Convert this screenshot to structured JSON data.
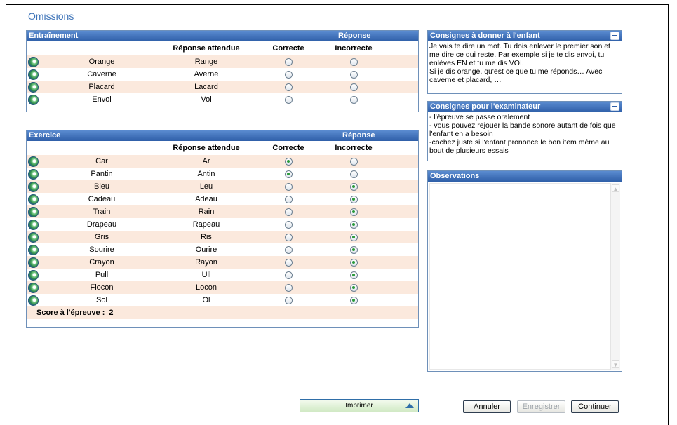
{
  "page": {
    "title": "Omissions"
  },
  "training": {
    "title": "Entraînement",
    "response_header": "Réponse",
    "col_expected": "Réponse attendue",
    "col_correct": "Correcte",
    "col_incorrect": "Incorrecte",
    "rows": [
      {
        "word": "Orange",
        "expected": "Range",
        "correct": false,
        "incorrect": false
      },
      {
        "word": "Caverne",
        "expected": "Averne",
        "correct": false,
        "incorrect": false
      },
      {
        "word": "Placard",
        "expected": "Lacard",
        "correct": false,
        "incorrect": false
      },
      {
        "word": "Envoi",
        "expected": "Voi",
        "correct": false,
        "incorrect": false
      }
    ]
  },
  "exercise": {
    "title": "Exercice",
    "response_header": "Réponse",
    "col_expected": "Réponse attendue",
    "col_correct": "Correcte",
    "col_incorrect": "Incorrecte",
    "rows": [
      {
        "word": "Car",
        "expected": "Ar",
        "correct": true,
        "incorrect": false
      },
      {
        "word": "Pantin",
        "expected": "Antin",
        "correct": true,
        "incorrect": false
      },
      {
        "word": "Bleu",
        "expected": "Leu",
        "correct": false,
        "incorrect": true
      },
      {
        "word": "Cadeau",
        "expected": "Adeau",
        "correct": false,
        "incorrect": true
      },
      {
        "word": "Train",
        "expected": "Rain",
        "correct": false,
        "incorrect": true
      },
      {
        "word": "Drapeau",
        "expected": "Rapeau",
        "correct": false,
        "incorrect": true
      },
      {
        "word": "Gris",
        "expected": "Ris",
        "correct": false,
        "incorrect": true
      },
      {
        "word": "Sourire",
        "expected": "Ourire",
        "correct": false,
        "incorrect": true
      },
      {
        "word": "Crayon",
        "expected": "Rayon",
        "correct": false,
        "incorrect": true
      },
      {
        "word": "Pull",
        "expected": "Ull",
        "correct": false,
        "incorrect": true
      },
      {
        "word": "Flocon",
        "expected": "Locon",
        "correct": false,
        "incorrect": true
      },
      {
        "word": "Sol",
        "expected": "Ol",
        "correct": false,
        "incorrect": true
      }
    ],
    "score_label": "Score à l'épreuve :",
    "score_value": "2"
  },
  "child_instructions": {
    "title": "Consignes à donner à l'enfant",
    "text": "Je vais te dire un mot. Tu dois enlever le premier son et me dire ce qui reste. Par exemple si je te dis envoi, tu enlèves EN et tu me dis VOI.\nSi je dis orange, qu'est ce que tu me réponds… Avec caverne et placard, …"
  },
  "examiner_instructions": {
    "title": "Consignes pour l'examinateur",
    "text": "- l'épreuve se passe oralement\n- vous pouvez rejouer la bande sonore autant de fois que l'enfant en a besoin\n-cochez juste si l'enfant prononce le bon item même au bout de plusieurs essais"
  },
  "observations": {
    "title": "Observations",
    "value": ""
  },
  "buttons": {
    "print": "Imprimer",
    "cancel": "Annuler",
    "save": "Enregistrer",
    "continue": "Continuer"
  },
  "icons": {
    "play": "play-sound-icon",
    "minimize": "minimize-icon",
    "print_arrow": "arrow-up-icon"
  },
  "colors": {
    "header_blue": "#2f5fa8",
    "row_alt": "#fbe9dd",
    "title_blue": "#3d73b8"
  }
}
